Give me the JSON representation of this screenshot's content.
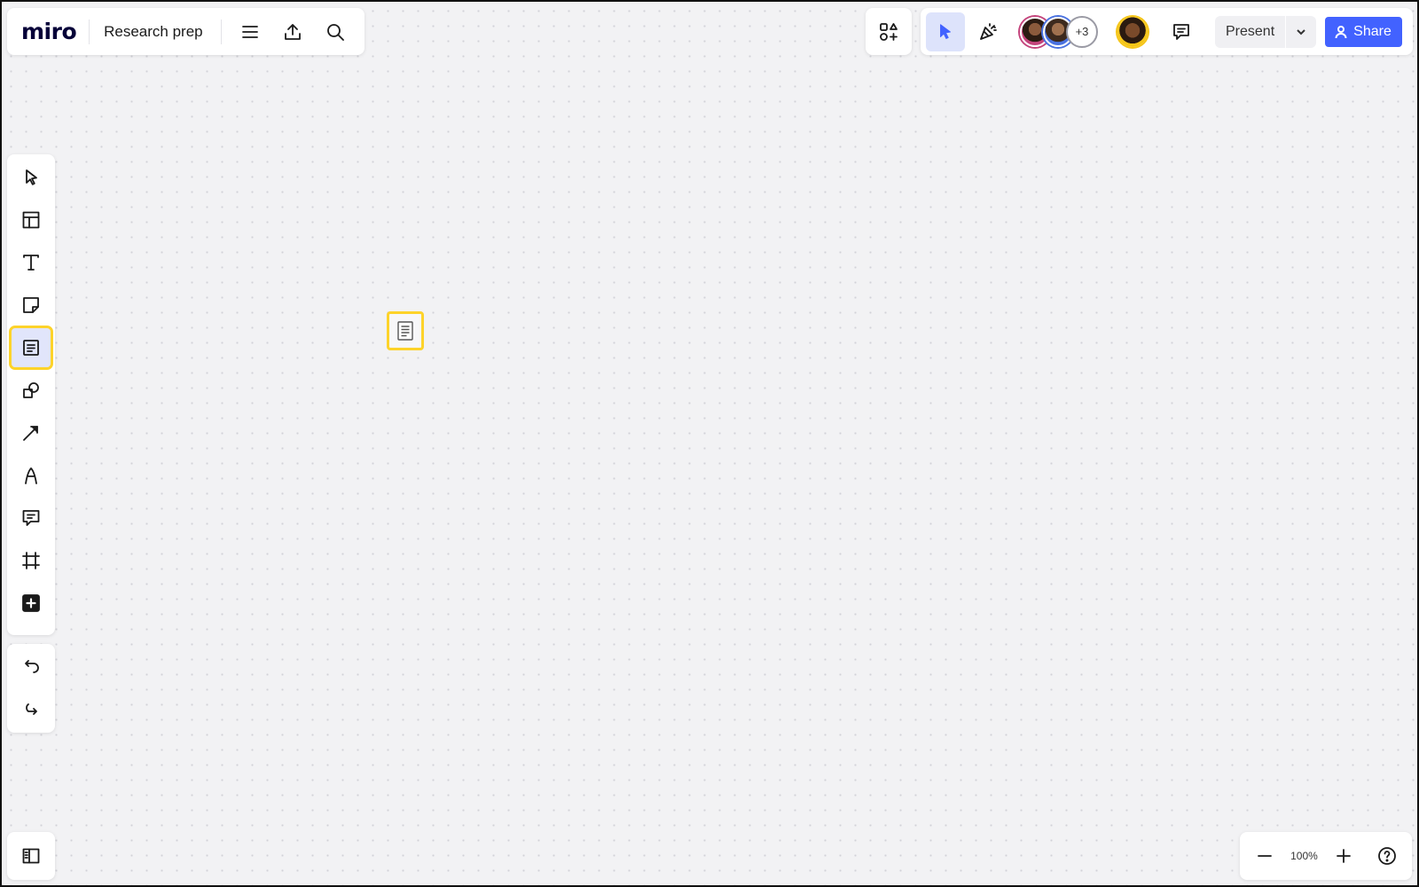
{
  "board": {
    "logo": "miro",
    "title": "Research prep"
  },
  "top_icons": {
    "menu": "hamburger-icon",
    "export": "upload-icon",
    "search": "search-icon",
    "apps": "apps-add-icon",
    "reactions": "party-popper-icon",
    "comments": "comment-icon"
  },
  "collaborators": {
    "extra_count": "+3"
  },
  "present": {
    "label": "Present"
  },
  "share": {
    "label": "Share"
  },
  "toolbar": {
    "tools": [
      "select",
      "templates",
      "text",
      "sticky-note",
      "document",
      "shapes",
      "connection-line",
      "pen",
      "comment",
      "frame",
      "more-tools"
    ],
    "active_tool": "document"
  },
  "zoom": {
    "level": "100%"
  },
  "colors": {
    "accent": "#4262ff",
    "highlight": "#fdd32a",
    "active_bg": "#e1e5fb",
    "canvas": "#f2f2f4"
  }
}
